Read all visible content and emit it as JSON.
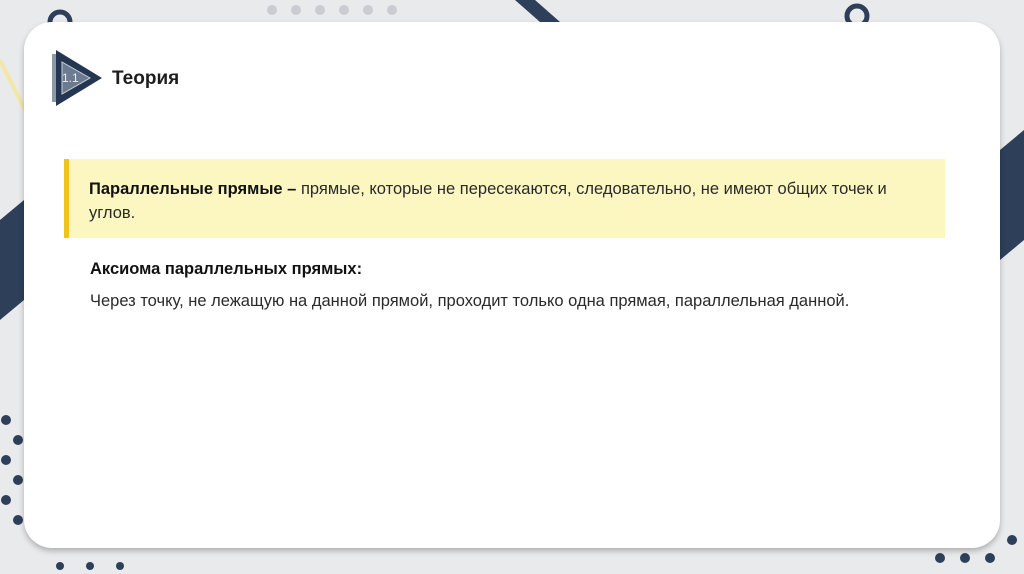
{
  "header": {
    "section_number": "1.1",
    "title": "Теория"
  },
  "definition": {
    "term": "Параллельные прямые",
    "dash": " – ",
    "text": "прямые, которые не пересекаются, следовательно, не имеют общих точек и углов."
  },
  "axiom": {
    "heading": "Аксиома параллельных прямых:",
    "text": "Через точку, не лежащую на данной прямой, проходит только одна прямая, параллельная данной."
  },
  "colors": {
    "accent": "#f0c419",
    "highlight": "#fcf6c1",
    "navy": "#253650"
  }
}
